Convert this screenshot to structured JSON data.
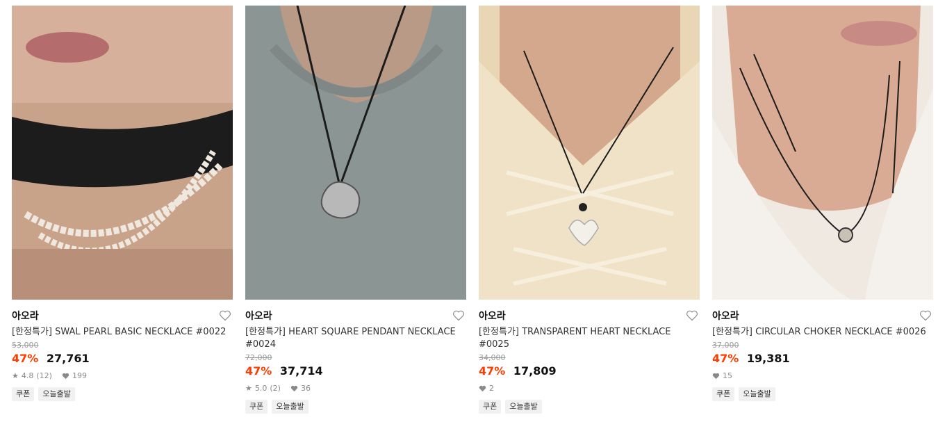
{
  "products": [
    {
      "brand": "아오라",
      "title": "[한정특가] SWAL PEARL BASIC NECKLACE #0022",
      "original_price": "53,000",
      "discount": "47%",
      "price": "27,761",
      "rating": "4.8",
      "reviews": "(12)",
      "likes": "199",
      "tags": [
        "쿠폰",
        "오늘출발"
      ]
    },
    {
      "brand": "아오라",
      "title": "[한정특가] HEART SQUARE PENDANT NECKLACE #0024",
      "original_price": "72,000",
      "discount": "47%",
      "price": "37,714",
      "rating": "5.0",
      "reviews": "(2)",
      "likes": "36",
      "tags": [
        "쿠폰",
        "오늘출발"
      ]
    },
    {
      "brand": "아오라",
      "title": "[한정특가] TRANSPARENT HEART NECKLACE #0025",
      "original_price": "34,000",
      "discount": "47%",
      "price": "17,809",
      "likes": "2",
      "tags": [
        "쿠폰",
        "오늘출발"
      ]
    },
    {
      "brand": "아오라",
      "title": "[한정특가] CIRCULAR CHOKER NECKLACE #0026",
      "original_price": "37,000",
      "discount": "47%",
      "price": "19,381",
      "likes": "15",
      "tags": [
        "쿠폰",
        "오늘출발"
      ]
    }
  ],
  "colors": {
    "discount": "#ff3b00",
    "muted": "#8a8a8a",
    "tag_bg": "#f1f1f1"
  },
  "icons": {
    "wishlist": "heart-outline-icon",
    "rating": "star-icon",
    "likes": "heart-filled-icon"
  }
}
